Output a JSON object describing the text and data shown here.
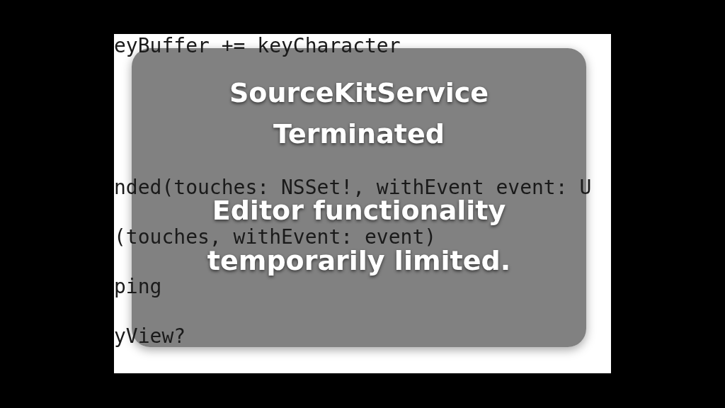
{
  "code_lines": [
    "eyBuffer += keyCharacter",
    "nded(touches: NSSet!, withEvent event: U",
    "(touches, withEvent: event)",
    "ping",
    "yView?"
  ],
  "hud": {
    "title_lines": [
      "SourceKitService",
      "Terminated"
    ],
    "message_lines": [
      "Editor functionality",
      "temporarily limited."
    ]
  }
}
